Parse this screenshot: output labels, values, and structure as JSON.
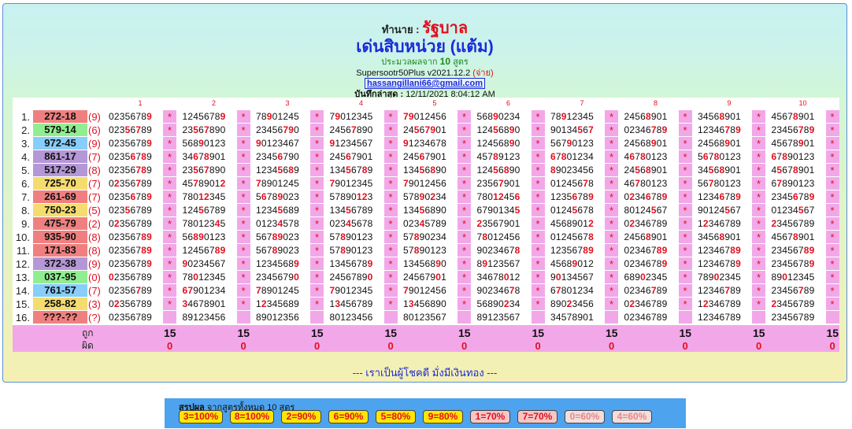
{
  "header": {
    "title_prefix": "ทำนาย :",
    "title_main": "รัฐบาล",
    "subtitle": "เด่นสิบหน่วย (แต้ม)",
    "formula_note_a": "ประมวลผลจาก",
    "formula_note_count": "10",
    "formula_note_b": "สูตร",
    "version": "Supersootr50Plus v2021.12.2",
    "version_tag": "(จ่าย)",
    "email": "hassangillani66@gmail.com",
    "saved_label": "บันทึกล่าสุด :",
    "saved_time": "12/11/2021 8:04:12 AM"
  },
  "columns": [
    "1",
    "2",
    "3",
    "4",
    "5",
    "6",
    "7",
    "8",
    "9",
    "10"
  ],
  "rows": [
    {
      "n": "1.",
      "result": "272-18",
      "count": "(9)",
      "color": "#f08080",
      "cells": [
        [
          "02356789",
          "9"
        ],
        [
          "12456789",
          "9"
        ],
        [
          "78901245",
          "9"
        ],
        [
          "79012345",
          "9"
        ],
        [
          "79012456",
          "7,9"
        ],
        [
          "56890234",
          "9"
        ],
        [
          "78912345",
          "9"
        ],
        [
          "24568901",
          "8"
        ],
        [
          "34568901",
          "8"
        ],
        [
          "45678901",
          "8"
        ]
      ]
    },
    {
      "n": "2.",
      "result": "579-14",
      "count": "(6)",
      "color": "#90ee90",
      "cells": [
        [
          "02356789",
          "5,7"
        ],
        [
          "23567890",
          "5,7"
        ],
        [
          "23456790",
          "7,9"
        ],
        [
          "24567890",
          "7"
        ],
        [
          "24567901",
          "5,7,9"
        ],
        [
          "12456890",
          "5,9"
        ],
        [
          "90134567",
          "5,7"
        ],
        [
          "02346789",
          "7,9"
        ],
        [
          "12346789",
          "7,9"
        ],
        [
          "23456789",
          "7,9"
        ]
      ]
    },
    {
      "n": "3.",
      "result": "972-45",
      "count": "(9)",
      "color": "#87cefa",
      "cells": [
        [
          "02356789",
          "9"
        ],
        [
          "56890123",
          "9"
        ],
        [
          "90123467",
          "9"
        ],
        [
          "91234567",
          "9"
        ],
        [
          "91234678",
          "9"
        ],
        [
          "12456890",
          "9"
        ],
        [
          "56790123",
          "9"
        ],
        [
          "24568901",
          "9"
        ],
        [
          "24568901",
          "9"
        ],
        [
          "45678901",
          "9"
        ]
      ]
    },
    {
      "n": "4.",
      "result": "861-17",
      "count": "(7)",
      "color": "#b497d6",
      "cells": [
        [
          "02356789",
          "6,8"
        ],
        [
          "34678901",
          "6,8"
        ],
        [
          "23456790",
          "6"
        ],
        [
          "24567901",
          "6"
        ],
        [
          "24567901",
          "6"
        ],
        [
          "45789123",
          "8"
        ],
        [
          "67801234",
          "6,8"
        ],
        [
          "46780123",
          "6,8"
        ],
        [
          "56780123",
          "6,8"
        ],
        [
          "67890123",
          "6,8"
        ]
      ]
    },
    {
      "n": "5.",
      "result": "517-29",
      "count": "(8)",
      "color": "#b497d6",
      "cells": [
        [
          "02356789",
          "7,8"
        ],
        [
          "23567890",
          "5,7"
        ],
        [
          "12345689",
          "5,8"
        ],
        [
          "13456789",
          "5,8"
        ],
        [
          "13456890",
          "5,8"
        ],
        [
          "12456890",
          "5,8"
        ],
        [
          "89023456",
          "8"
        ],
        [
          "24568901",
          "5,8"
        ],
        [
          "34568901",
          "5,8"
        ],
        [
          "45678901",
          "5,8"
        ]
      ]
    },
    {
      "n": "6.",
      "result": "725-70",
      "count": "(7)",
      "color": "#f5dc6e",
      "cells": [
        [
          "02356789",
          "2,7"
        ],
        [
          "45789012",
          "2,7"
        ],
        [
          "78901245",
          "7"
        ],
        [
          "79012345",
          "7"
        ],
        [
          "79012456",
          "7"
        ],
        [
          "23567901",
          "7"
        ],
        [
          "01245678",
          "7"
        ],
        [
          "46780123",
          "7"
        ],
        [
          "56780123",
          "7"
        ],
        [
          "67890123",
          "7"
        ]
      ]
    },
    {
      "n": "7.",
      "result": "261-69",
      "count": "(7)",
      "color": "#f08080",
      "cells": [
        [
          "02356789",
          "6,9"
        ],
        [
          "78012345",
          "1,2"
        ],
        [
          "56789023",
          "6,9"
        ],
        [
          "57890123",
          "1,2"
        ],
        [
          "57890234",
          "2,9"
        ],
        [
          "78012456",
          "1,2,6"
        ],
        [
          "12356789",
          "6,9"
        ],
        [
          "02346789",
          "2,6,9"
        ],
        [
          "12346789",
          "6,9"
        ],
        [
          "23456789",
          "6,9"
        ]
      ]
    },
    {
      "n": "8.",
      "result": "750-23",
      "count": "(5)",
      "color": "#f5dc6e",
      "cells": [
        [
          "02356789",
          "5"
        ],
        [
          "12456789",
          "5"
        ],
        [
          "12345689",
          "5"
        ],
        [
          "13456789",
          "5"
        ],
        [
          "13456890",
          "5"
        ],
        [
          "67901345",
          "5"
        ],
        [
          "01245678",
          "5"
        ],
        [
          "80124567",
          "5"
        ],
        [
          "90124567",
          "5"
        ],
        [
          "01234567",
          "5"
        ]
      ]
    },
    {
      "n": "9.",
      "result": "475-79",
      "count": "(2)",
      "color": "#f08080",
      "cells": [
        [
          "02356789",
          "2"
        ],
        [
          "78012345",
          "4"
        ],
        [
          "01234578",
          "4"
        ],
        [
          "02345678",
          "4"
        ],
        [
          "02345789",
          "4"
        ],
        [
          "23567901",
          "2"
        ],
        [
          "45689012",
          "2"
        ],
        [
          "02346789",
          "2"
        ],
        [
          "12346789",
          "2"
        ],
        [
          "23456789",
          "2"
        ]
      ]
    },
    {
      "n": "10.",
      "result": "935-90",
      "count": "(8)",
      "color": "#f08080",
      "cells": [
        [
          "02356789",
          "8,9"
        ],
        [
          "56890123",
          "8,9"
        ],
        [
          "56789023",
          "8,9"
        ],
        [
          "57890123",
          "8"
        ],
        [
          "57890234",
          "8"
        ],
        [
          "78012456",
          "8"
        ],
        [
          "01245678",
          "8"
        ],
        [
          "24568901",
          "8"
        ],
        [
          "34568901",
          "8"
        ],
        [
          "45678901",
          "8"
        ]
      ]
    },
    {
      "n": "11.",
      "result": "171-83",
      "count": "(8)",
      "color": "#f08080",
      "cells": [
        [
          "02356789",
          "8,9"
        ],
        [
          "12456789",
          "8,9"
        ],
        [
          "56789023",
          "8"
        ],
        [
          "57890123",
          "8"
        ],
        [
          "57890123",
          "8"
        ],
        [
          "90234678",
          "8"
        ],
        [
          "12356789",
          "8,9"
        ],
        [
          "02346789",
          "8,9"
        ],
        [
          "12346789",
          "8,9"
        ],
        [
          "23456789",
          "8,9"
        ]
      ]
    },
    {
      "n": "12.",
      "result": "372-38",
      "count": "(9)",
      "color": "#b497d6",
      "cells": [
        [
          "02356789",
          "9"
        ],
        [
          "90234567",
          "9"
        ],
        [
          "12345689",
          "9"
        ],
        [
          "13456789",
          "9"
        ],
        [
          "13456890",
          "9"
        ],
        [
          "89123567",
          "9"
        ],
        [
          "45689012",
          "9"
        ],
        [
          "02346789",
          "9"
        ],
        [
          "12346789",
          "9"
        ],
        [
          "23456789",
          "9"
        ]
      ]
    },
    {
      "n": "13.",
      "result": "037-95",
      "count": "(0)",
      "color": "#90ee90",
      "cells": [
        [
          "02356789",
          "0"
        ],
        [
          "78012345",
          "0"
        ],
        [
          "23456790",
          "0"
        ],
        [
          "24567890",
          "0"
        ],
        [
          "24567901",
          "0"
        ],
        [
          "34678012",
          "0"
        ],
        [
          "90134567",
          "0"
        ],
        [
          "68902345",
          "0"
        ],
        [
          "78902345",
          "0"
        ],
        [
          "89012345",
          "0"
        ]
      ]
    },
    {
      "n": "14.",
      "result": "761-57",
      "count": "(7)",
      "color": "#87cefa",
      "cells": [
        [
          "02356789",
          "7"
        ],
        [
          "67901234",
          "6,7"
        ],
        [
          "78901245",
          "7"
        ],
        [
          "79012345",
          "7"
        ],
        [
          "79012456",
          "7"
        ],
        [
          "90234678",
          "7"
        ],
        [
          "67801234",
          "7"
        ],
        [
          "02346789",
          "7"
        ],
        [
          "12346789",
          "7"
        ],
        [
          "23456789",
          "7"
        ]
      ]
    },
    {
      "n": "15.",
      "result": "258-82",
      "count": "(3)",
      "color": "#f5dc6e",
      "cells": [
        [
          "02356789",
          "2"
        ],
        [
          "34678901",
          "3"
        ],
        [
          "12345689",
          "2"
        ],
        [
          "13456789",
          "3"
        ],
        [
          "13456890",
          "3"
        ],
        [
          "56890234",
          "2"
        ],
        [
          "89023456",
          "2"
        ],
        [
          "02346789",
          "2"
        ],
        [
          "12346789",
          "2"
        ],
        [
          "23456789",
          "2"
        ]
      ]
    },
    {
      "n": "16.",
      "result": "???-??",
      "count": "(?)",
      "color": "#f08080",
      "cells": [
        [
          "02356789",
          ""
        ],
        [
          "89123456",
          ""
        ],
        [
          "89012356",
          ""
        ],
        [
          "80123456",
          ""
        ],
        [
          "80123567",
          ""
        ],
        [
          "89123567",
          ""
        ],
        [
          "34578901",
          ""
        ],
        [
          "02346789",
          ""
        ],
        [
          "12346789",
          ""
        ],
        [
          "23456789",
          ""
        ]
      ]
    }
  ],
  "footer": {
    "label_hit": "ถูก",
    "label_miss": "ผิด",
    "hits": [
      "15",
      "15",
      "15",
      "15",
      "15",
      "15",
      "15",
      "15",
      "15",
      "15"
    ],
    "misses": [
      "0",
      "0",
      "0",
      "0",
      "0",
      "0",
      "0",
      "0",
      "0",
      "0"
    ]
  },
  "slogan": "--- เราเป็นผู้โชคดี มั่งมีเงินทอง ---",
  "summary": {
    "title_bold": "สรุปผล",
    "title_rest": "จากสูตรทั้งหมด 10 สูตร",
    "badges": [
      {
        "label": "3=100%",
        "bg": "#ffe600",
        "fg": "#e01020"
      },
      {
        "label": "8=100%",
        "bg": "#ffe600",
        "fg": "#e01020"
      },
      {
        "label": "2=90%",
        "bg": "#ffe600",
        "fg": "#e01020"
      },
      {
        "label": "6=90%",
        "bg": "#ffe600",
        "fg": "#e01020"
      },
      {
        "label": "5=80%",
        "bg": "#ffe600",
        "fg": "#e01020"
      },
      {
        "label": "9=80%",
        "bg": "#ffe600",
        "fg": "#e01020"
      },
      {
        "label": "1=70%",
        "bg": "#f5c6c6",
        "fg": "#e01020"
      },
      {
        "label": "7=70%",
        "bg": "#f5c6c6",
        "fg": "#e01020"
      },
      {
        "label": "0=60%",
        "bg": "#f2dede",
        "fg": "#e58888"
      },
      {
        "label": "4=60%",
        "bg": "#f2dede",
        "fg": "#e58888"
      }
    ]
  }
}
